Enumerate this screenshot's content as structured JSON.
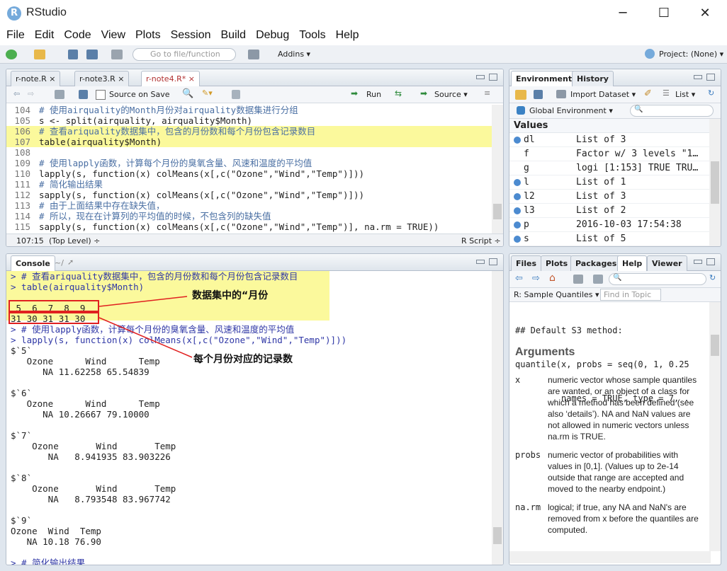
{
  "window": {
    "title": "RStudio",
    "app_icon": "R"
  },
  "menu": [
    "File",
    "Edit",
    "Code",
    "View",
    "Plots",
    "Session",
    "Build",
    "Debug",
    "Tools",
    "Help"
  ],
  "toolbar": {
    "goto_placeholder": "Go to file/function",
    "addins": "Addins ▾",
    "project": "Project: (None) ▾"
  },
  "editor": {
    "tabs": [
      "r-note.R ×",
      "r-note3.R ×",
      "r-note4.R* ×"
    ],
    "source_on_save": "Source on Save",
    "run": "Run",
    "source": "Source ▾",
    "lines": [
      {
        "n": "104",
        "t": "# 使用airquality的Month月份对airquality数据集进行分组",
        "k": "cmt"
      },
      {
        "n": "105",
        "t": "s <- split(airquality, airquality$Month)",
        "k": "code"
      },
      {
        "n": "106",
        "t": "# 查看ariquality数据集中，包含的月份数和每个月份包含记录数目",
        "k": "cmt",
        "hl": true
      },
      {
        "n": "107",
        "t": "table(airquality$Month)",
        "k": "code",
        "hl": true
      },
      {
        "n": "108",
        "t": "",
        "k": "code"
      },
      {
        "n": "109",
        "t": "# 使用lapply函数，计算每个月份的臭氧含量、风速和温度的平均值",
        "k": "cmt"
      },
      {
        "n": "110",
        "t": "lapply(s, function(x) colMeans(x[,c(\"Ozone\",\"Wind\",\"Temp\")]))",
        "k": "code"
      },
      {
        "n": "111",
        "t": "# 简化输出结果",
        "k": "cmt"
      },
      {
        "n": "112",
        "t": "sapply(s, function(x) colMeans(x[,c(\"Ozone\",\"Wind\",\"Temp\")]))",
        "k": "code"
      },
      {
        "n": "113",
        "t": "# 由于上面结果中存在缺失值，",
        "k": "cmt"
      },
      {
        "n": "114",
        "t": "# 所以，现在在计算列的平均值的时候，不包含列的缺失值",
        "k": "cmt"
      },
      {
        "n": "115",
        "t": "sapply(s, function(x) colMeans(x[,c(\"Ozone\",\"Wind\",\"Temp\")], na.rm = TRUE))",
        "k": "code"
      }
    ],
    "status_pos": "107:15",
    "status_level": "(Top Level) ÷",
    "status_type": "R Script ÷"
  },
  "console": {
    "title": "Console",
    "path": "~/",
    "lines": [
      {
        "t": "> # 查看ariquality数据集中，包含的月份数和每个月份包含记录数目",
        "c": "#2f37a6",
        "hl": true
      },
      {
        "t": "> table(airquality$Month)",
        "c": "#2f37a6",
        "hl": true
      },
      {
        "t": "",
        "c": "#222",
        "hl": true
      },
      {
        "t": " 5  6  7  8  9",
        "c": "#222",
        "hl": true
      },
      {
        "t": "31 30 31 31 30",
        "c": "#222",
        "hl": true
      },
      {
        "t": "> # 使用lapply函数，计算每个月份的臭氧含量、风速和温度的平均值",
        "c": "#2f37a6"
      },
      {
        "t": "> lapply(s, function(x) colMeans(x[,c(\"Ozone\",\"Wind\",\"Temp\")]))",
        "c": "#2f37a6"
      },
      {
        "t": "$`5`",
        "c": "#222"
      },
      {
        "t": "   Ozone      Wind      Temp",
        "c": "#222"
      },
      {
        "t": "      NA 11.62258 65.54839",
        "c": "#222"
      },
      {
        "t": "",
        "c": "#222"
      },
      {
        "t": "$`6`",
        "c": "#222"
      },
      {
        "t": "   Ozone      Wind      Temp",
        "c": "#222"
      },
      {
        "t": "      NA 10.26667 79.10000",
        "c": "#222"
      },
      {
        "t": "",
        "c": "#222"
      },
      {
        "t": "$`7`",
        "c": "#222"
      },
      {
        "t": "    Ozone       Wind       Temp",
        "c": "#222"
      },
      {
        "t": "       NA   8.941935 83.903226",
        "c": "#222"
      },
      {
        "t": "",
        "c": "#222"
      },
      {
        "t": "$`8`",
        "c": "#222"
      },
      {
        "t": "    Ozone       Wind       Temp",
        "c": "#222"
      },
      {
        "t": "       NA   8.793548 83.967742",
        "c": "#222"
      },
      {
        "t": "",
        "c": "#222"
      },
      {
        "t": "$`9`",
        "c": "#222"
      },
      {
        "t": "Ozone  Wind  Temp",
        "c": "#222"
      },
      {
        "t": "   NA 10.18 76.90",
        "c": "#222"
      },
      {
        "t": "",
        "c": "#222"
      },
      {
        "t": "> # 简化输出结果",
        "c": "#2f37a6"
      }
    ],
    "annotation1": "数据集中的“月份",
    "annotation2": "每个月份对应的记录数"
  },
  "environment": {
    "tabs": [
      "Environment",
      "History"
    ],
    "import": "Import Dataset ▾",
    "list": "List ▾",
    "global": "Global Environment ▾",
    "section": "Values",
    "rows": [
      {
        "name": "dl",
        "value": "List of 3",
        "dot": true
      },
      {
        "name": "f",
        "value": "Factor w/ 3 levels \"1…",
        "dot": false
      },
      {
        "name": "g",
        "value": "logi [1:153] TRUE TRU…",
        "dot": false
      },
      {
        "name": "l",
        "value": "List of 1",
        "dot": true
      },
      {
        "name": "l2",
        "value": "List of 3",
        "dot": true
      },
      {
        "name": "l3",
        "value": "List of 2",
        "dot": true
      },
      {
        "name": "p",
        "value": "2016-10-03 17:54:38",
        "dot": true
      },
      {
        "name": "s",
        "value": "List of 5",
        "dot": true
      }
    ]
  },
  "help": {
    "tabs": [
      "Files",
      "Plots",
      "Packages",
      "Help",
      "Viewer"
    ],
    "topic": "R: Sample Quantiles ▾",
    "find_placeholder": "Find in Topic",
    "code1": "## Default S3 method:",
    "code2": "quantile(x, probs = seq(0, 1, 0.25",
    "code3": "         names = TRUE, type = 7, .",
    "heading": "Arguments",
    "args": [
      {
        "name": "x",
        "desc": "numeric vector whose sample quantiles are wanted, or an object of a class for which a method has been defined (see also ‘details’). NA and NaN values are not allowed in numeric vectors unless na.rm is TRUE."
      },
      {
        "name": "probs",
        "desc": "numeric vector of probabilities with values in [0,1]. (Values up to 2e-14 outside that range are accepted and moved to the nearby endpoint.)"
      },
      {
        "name": "na.rm",
        "desc": "logical; if true, any NA and NaN's are removed from x before the quantiles are computed."
      }
    ]
  }
}
